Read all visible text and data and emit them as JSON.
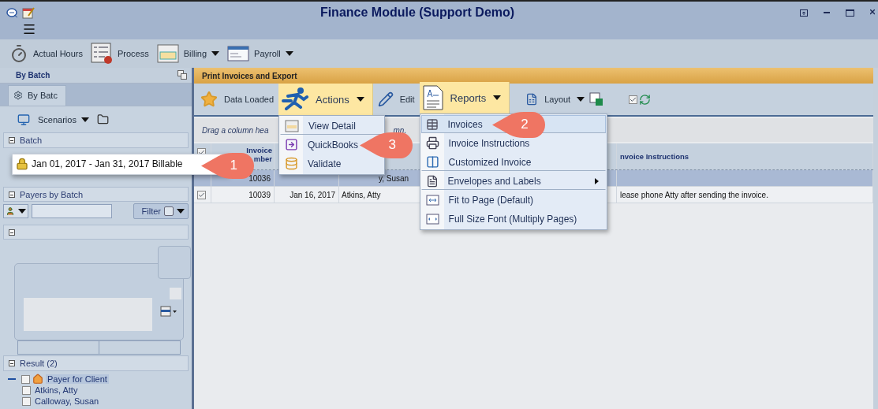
{
  "window": {
    "title": "Finance Module (Support Demo)"
  },
  "main_toolbar": [
    {
      "label": "Actual Hours",
      "dropdown": false
    },
    {
      "label": "Process",
      "dropdown": false
    },
    {
      "label": "Billing",
      "dropdown": true
    },
    {
      "label": "Payroll",
      "dropdown": true
    }
  ],
  "left_panel": {
    "title": "By Batch",
    "tab": {
      "label": "By Batc",
      "selected": true
    },
    "scenarios_label": "Scenarios",
    "batch_header": "Batch",
    "batch_item": "Jan 01, 2017 - Jan 31, 2017 Billable",
    "payers_header": "Payers by Batch",
    "filter_button": "Filter",
    "result_header": "Result (2)",
    "tree": [
      {
        "label": "Payer for Client",
        "selected": true,
        "expanded": true,
        "checked": false,
        "children": [
          {
            "label": "Atkins, Atty",
            "selected": false,
            "checked": false
          },
          {
            "label": "Calloway, Susan",
            "selected": false,
            "checked": false
          }
        ]
      }
    ]
  },
  "content": {
    "title": "Print Invoices and Export",
    "toolbar": [
      {
        "kind": "button",
        "label": "Data Loaded"
      },
      {
        "kind": "menu",
        "label": "Actions",
        "expanded": true,
        "items": [
          {
            "label": "View Detail",
            "highlighted": false,
            "separator_after": true
          },
          {
            "label": "QuickBooks",
            "highlighted": false,
            "separator_after": false
          },
          {
            "label": "Validate",
            "highlighted": false,
            "separator_after": false
          }
        ]
      },
      {
        "kind": "button",
        "label": "Edit"
      },
      {
        "kind": "menu",
        "label": "Reports",
        "expanded": true,
        "items": [
          {
            "label": "Invoices",
            "highlighted": true,
            "separator_after": true,
            "submenu": false
          },
          {
            "label": "Invoice Instructions",
            "highlighted": false,
            "separator_after": false,
            "submenu": false
          },
          {
            "label": "Customized Invoice",
            "highlighted": false,
            "separator_after": true,
            "submenu": false
          },
          {
            "label": "Envelopes and Labels",
            "highlighted": false,
            "separator_after": true,
            "submenu": true
          },
          {
            "label": "Fit to Page (Default)",
            "highlighted": false,
            "separator_after": false,
            "submenu": false
          },
          {
            "label": "Full Size Font (Multiply Pages)",
            "highlighted": false,
            "separator_after": false,
            "submenu": false
          }
        ]
      },
      {
        "kind": "split",
        "label": "Layout"
      }
    ],
    "auto_refresh": {
      "checked": true
    },
    "group_bar": [
      "Drag a column hea",
      "mn."
    ],
    "grid": {
      "header_checked": true,
      "columns": {
        "number": [
          "Invoice",
          "mber"
        ],
        "instructions": "nvoice Instructions"
      },
      "rows": [
        {
          "selected": true,
          "number": "10036",
          "name": "y, Susan"
        },
        {
          "selected": false,
          "checked": true,
          "number": "10039",
          "date": "Jan 16, 2017",
          "name": "Atkins, Atty",
          "instructions": "lease phone Atty after sending the invoice."
        }
      ]
    }
  },
  "callouts": [
    {
      "label": "1"
    },
    {
      "label": "2"
    },
    {
      "label": "3"
    }
  ]
}
